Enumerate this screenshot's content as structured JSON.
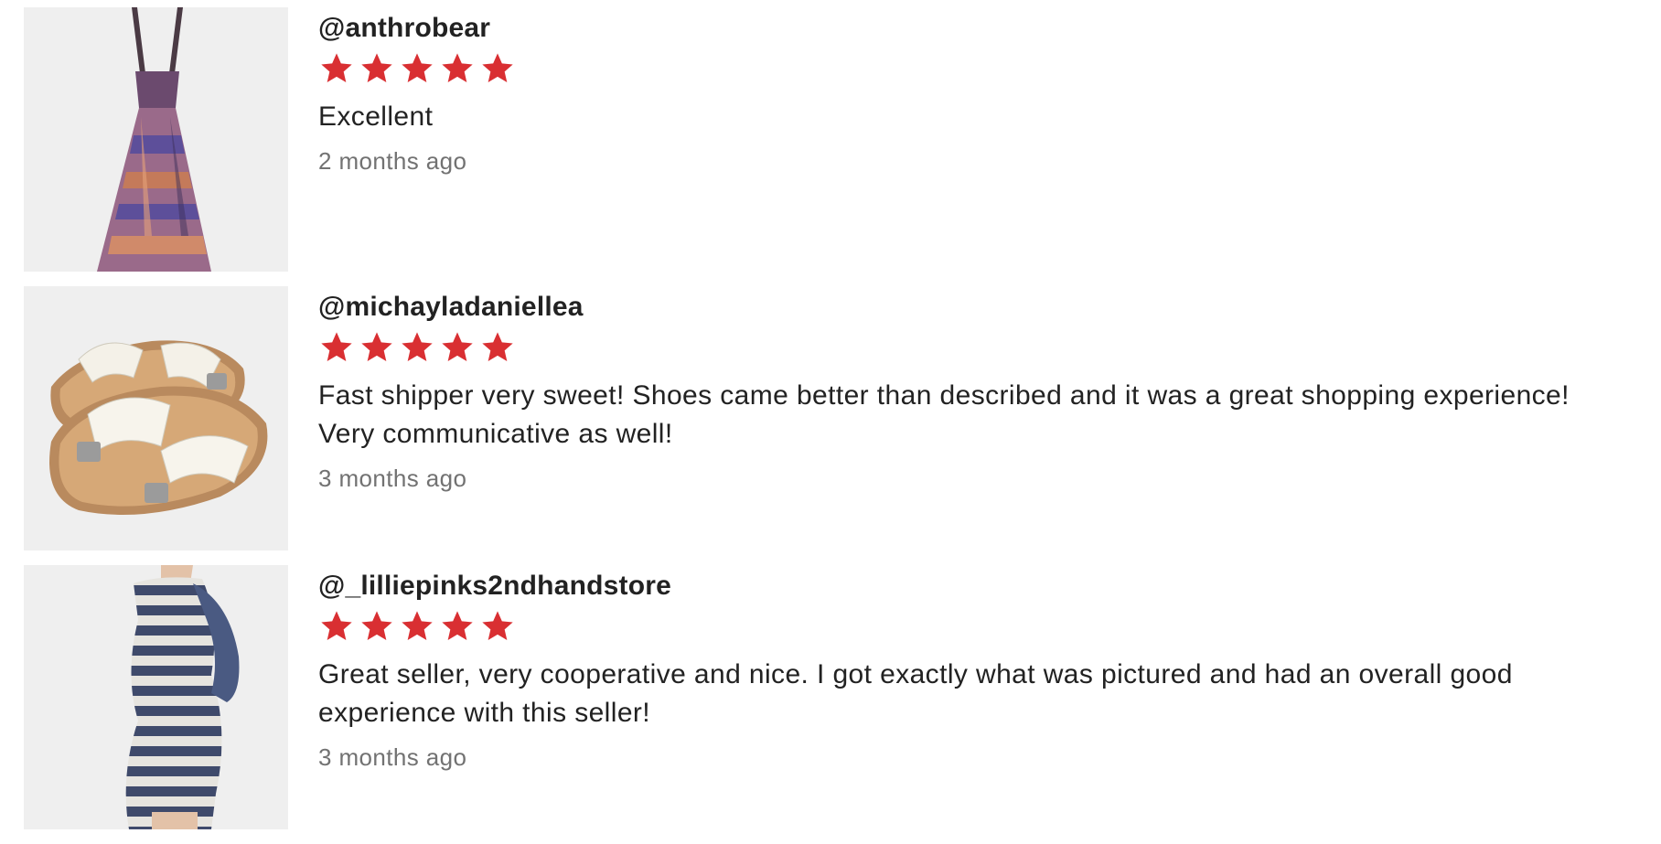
{
  "colors": {
    "star": "#d92f32",
    "thumb_bg": "#efefef",
    "timestamp": "#727272"
  },
  "reviews": [
    {
      "username": "@anthrobear",
      "rating": 5,
      "text": "Excellent",
      "time": "2 months ago",
      "image": "maxi-dress-photo"
    },
    {
      "username": "@michayladaniellea",
      "rating": 5,
      "text": "Fast shipper very sweet! Shoes came better than described and it was a great shopping experience! Very communicative as well!",
      "time": "3 months ago",
      "image": "white-sandals-photo"
    },
    {
      "username": "@_lilliepinks2ndhandstore",
      "rating": 5,
      "text": "Great seller, very cooperative and nice. I got exactly what was pictured and had an overall good experience with this seller!",
      "time": "3 months ago",
      "image": "striped-dress-photo"
    }
  ]
}
